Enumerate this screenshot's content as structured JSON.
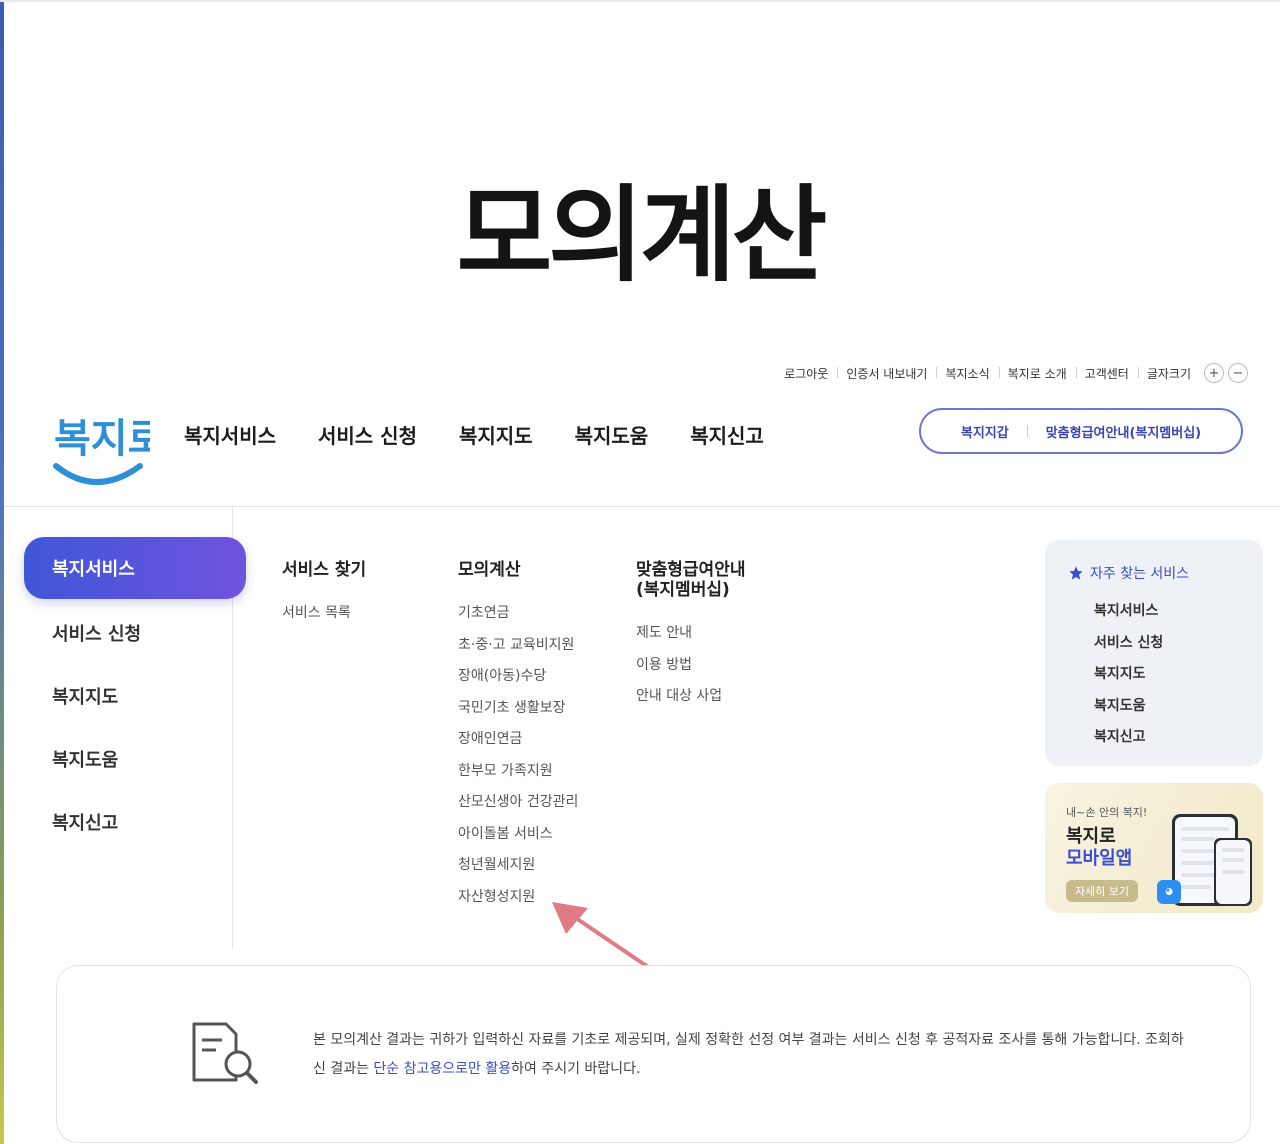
{
  "page": {
    "title": "모의계산"
  },
  "utility_nav": {
    "items": [
      "로그아웃",
      "인증서 내보내기",
      "복지소식",
      "복지로 소개",
      "고객센터",
      "글자크기"
    ],
    "font_plus": "+",
    "font_minus": "−"
  },
  "logo": {
    "text": "복지로"
  },
  "gnb": {
    "items": [
      "복지서비스",
      "서비스 신청",
      "복지지도",
      "복지도움",
      "복지신고"
    ]
  },
  "header_pill": {
    "left": "복지지갑",
    "right": "맞춤형급여안내(복지멤버십)"
  },
  "side_menu": {
    "active": "복지서비스",
    "items": [
      "서비스 신청",
      "복지지도",
      "복지도움",
      "복지신고"
    ]
  },
  "mega_menu": {
    "col1": {
      "title": "서비스 찾기",
      "links": [
        "서비스 목록"
      ]
    },
    "col2": {
      "title": "모의계산",
      "links": [
        "기초연금",
        "초·중·고 교육비지원",
        "장애(아동)수당",
        "국민기초 생활보장",
        "장애인연금",
        "한부모 가족지원",
        "산모신생아 건강관리",
        "아이돌봄 서비스",
        "청년월세지원",
        "자산형성지원"
      ]
    },
    "col3": {
      "title_line1": "맞춤형급여안내",
      "title_line2": "(복지멤버십)",
      "links": [
        "제도 안내",
        "이용 방법",
        "안내 대상 사업"
      ]
    }
  },
  "frequent": {
    "title": "자주 찾는 서비스",
    "items": [
      "복지서비스",
      "서비스 신청",
      "복지지도",
      "복지도움",
      "복지신고"
    ]
  },
  "app_promo": {
    "tag": "내~손 안의 복지!",
    "name_line1": "복지로",
    "name_line2": "모바일앱",
    "button": "자세히 보기"
  },
  "notice": {
    "text_before": "본 모의계산 결과는 귀하가 입력하신 자료를 기초로 제공되며, 실제 정확한 선정 여부 결과는 서비스 신청 후 공적자료 조사를 통해 가능합니다. 조회하신 결과는 ",
    "highlight": "단순 참고용으로만 활용",
    "text_after": "하여 주시기 바랍니다."
  },
  "colors": {
    "brand": "#3b4ecf",
    "active_gradient_start": "#3f57d8",
    "active_gradient_end": "#7052e0",
    "arrow": "#e07a84"
  }
}
